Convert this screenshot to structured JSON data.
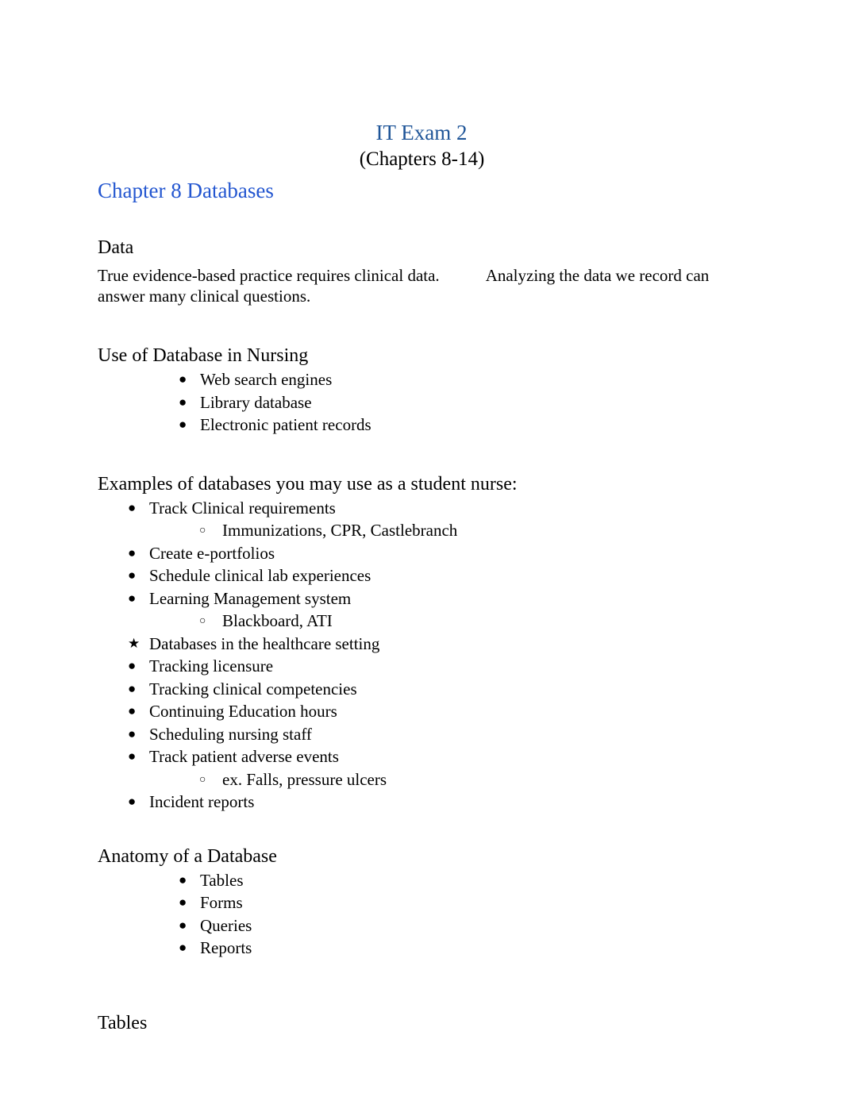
{
  "document": {
    "title": "IT Exam 2",
    "subtitle": "(Chapters 8-14)",
    "chapter_heading": "Chapter 8 Databases",
    "title_color": "#1f5598",
    "chapter_color": "#2356d0",
    "body_color": "#000000",
    "background": "#ffffff"
  },
  "sections": {
    "data": {
      "heading": "Data",
      "paragraph_part1": "True evidence-based practice requires clinical data.",
      "paragraph_part2": "Analyzing the data we record can answer many clinical questions."
    },
    "use_of_database": {
      "heading": "Use of Database in Nursing",
      "items": [
        {
          "marker": "disc-bullet",
          "text": "Web search engines"
        },
        {
          "marker": "disc-bullet",
          "text": "Library database"
        },
        {
          "marker": "disc-bullet",
          "text": "Electronic patient records"
        }
      ]
    },
    "examples": {
      "heading": "Examples of databases you may use as a student nurse:",
      "items": [
        {
          "marker": "disc-bullet",
          "text": "Track Clinical requirements",
          "sub": [
            {
              "marker": "circle-bullet",
              "text": "Immunizations, CPR, Castlebranch"
            }
          ]
        },
        {
          "marker": "disc-bullet",
          "text": "Create e-portfolios",
          "sub": []
        },
        {
          "marker": "disc-bullet",
          "text": "Schedule clinical lab experiences",
          "sub": []
        },
        {
          "marker": "disc-bullet",
          "text": "Learning Management system",
          "sub": [
            {
              "marker": "circle-bullet",
              "text": "Blackboard, ATI"
            }
          ]
        }
      ]
    },
    "healthcare_setting": {
      "items": [
        {
          "marker": "star-bullet",
          "text": "Databases in the healthcare setting",
          "sub": []
        },
        {
          "marker": "disc-bullet",
          "text": "Tracking licensure",
          "sub": []
        },
        {
          "marker": "disc-bullet",
          "text": "Tracking clinical competencies",
          "sub": []
        },
        {
          "marker": "disc-bullet",
          "text": "Continuing Education hours",
          "sub": []
        },
        {
          "marker": "disc-bullet",
          "text": "Scheduling nursing staff",
          "sub": []
        },
        {
          "marker": "disc-bullet",
          "text": "Track patient adverse events",
          "sub": [
            {
              "marker": "circle-bullet",
              "text": "ex. Falls, pressure ulcers"
            }
          ]
        },
        {
          "marker": "disc-bullet",
          "text": "Incident reports",
          "sub": []
        }
      ]
    },
    "anatomy": {
      "heading": "Anatomy of a Database",
      "items": [
        {
          "marker": "disc-bullet",
          "text": "Tables"
        },
        {
          "marker": "disc-bullet",
          "text": "Forms"
        },
        {
          "marker": "disc-bullet",
          "text": "Queries"
        },
        {
          "marker": "disc-bullet",
          "text": "Reports"
        }
      ]
    },
    "tables": {
      "heading": "Tables"
    }
  },
  "glyphs": {
    "disc-bullet": "●",
    "circle-bullet": "○",
    "star-bullet": "★"
  }
}
